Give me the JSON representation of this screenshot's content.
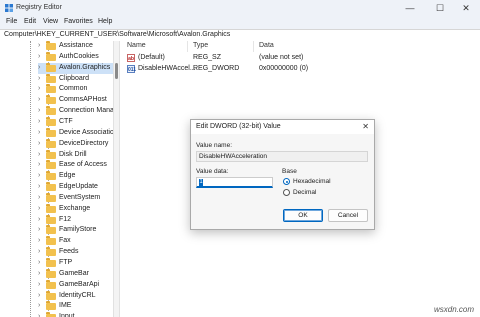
{
  "window": {
    "title": "Registry Editor",
    "minimize": "—",
    "maximize": "☐",
    "close": "✕"
  },
  "menu": [
    "File",
    "Edit",
    "View",
    "Favorites",
    "Help"
  ],
  "address": "Computer\\HKEY_CURRENT_USER\\Software\\Microsoft\\Avalon.Graphics",
  "tree": {
    "items": [
      {
        "label": "Assistance",
        "selected": false
      },
      {
        "label": "AuthCookies",
        "selected": false
      },
      {
        "label": "Avalon.Graphics",
        "selected": true
      },
      {
        "label": "Clipboard",
        "selected": false
      },
      {
        "label": "Common",
        "selected": false
      },
      {
        "label": "CommsAPHost",
        "selected": false
      },
      {
        "label": "Connection Mana",
        "selected": false
      },
      {
        "label": "CTF",
        "selected": false
      },
      {
        "label": "Device Associatio",
        "selected": false
      },
      {
        "label": "DeviceDirectory",
        "selected": false
      },
      {
        "label": "Disk Drill",
        "selected": false
      },
      {
        "label": "Ease of Access",
        "selected": false
      },
      {
        "label": "Edge",
        "selected": false
      },
      {
        "label": "EdgeUpdate",
        "selected": false
      },
      {
        "label": "EventSystem",
        "selected": false
      },
      {
        "label": "Exchange",
        "selected": false
      },
      {
        "label": "F12",
        "selected": false
      },
      {
        "label": "FamilyStore",
        "selected": false
      },
      {
        "label": "Fax",
        "selected": false
      },
      {
        "label": "Feeds",
        "selected": false
      },
      {
        "label": "FTP",
        "selected": false
      },
      {
        "label": "GameBar",
        "selected": false
      },
      {
        "label": "GameBarApi",
        "selected": false
      },
      {
        "label": "IdentityCRL",
        "selected": false
      },
      {
        "label": "IME",
        "selected": false
      },
      {
        "label": "Input",
        "selected": false
      }
    ]
  },
  "values": {
    "columns": {
      "name": "Name",
      "type": "Type",
      "data": "Data"
    },
    "rows": [
      {
        "icon": "string-value-icon",
        "icon_text": "ab",
        "name": "(Default)",
        "type": "REG_SZ",
        "data": "(value not set)"
      },
      {
        "icon": "binary-value-icon",
        "icon_text": "011",
        "name": "DisableHWAccel...",
        "type": "REG_DWORD",
        "data": "0x00000000 (0)"
      }
    ]
  },
  "dialog": {
    "title": "Edit DWORD (32-bit) Value",
    "close": "✕",
    "value_name_label": "Value name:",
    "value_name": "DisableHWAcceleration",
    "value_data_label": "Value data:",
    "value_data": "1",
    "base_label": "Base",
    "base_options": [
      {
        "label": "Hexadecimal",
        "selected": true
      },
      {
        "label": "Decimal",
        "selected": false
      }
    ],
    "ok": "OK",
    "cancel": "Cancel"
  },
  "watermark": "wsxdn.com",
  "colors": {
    "accent": "#0067c0",
    "folder": "#f2c14e",
    "selection": "#cde1f7"
  }
}
